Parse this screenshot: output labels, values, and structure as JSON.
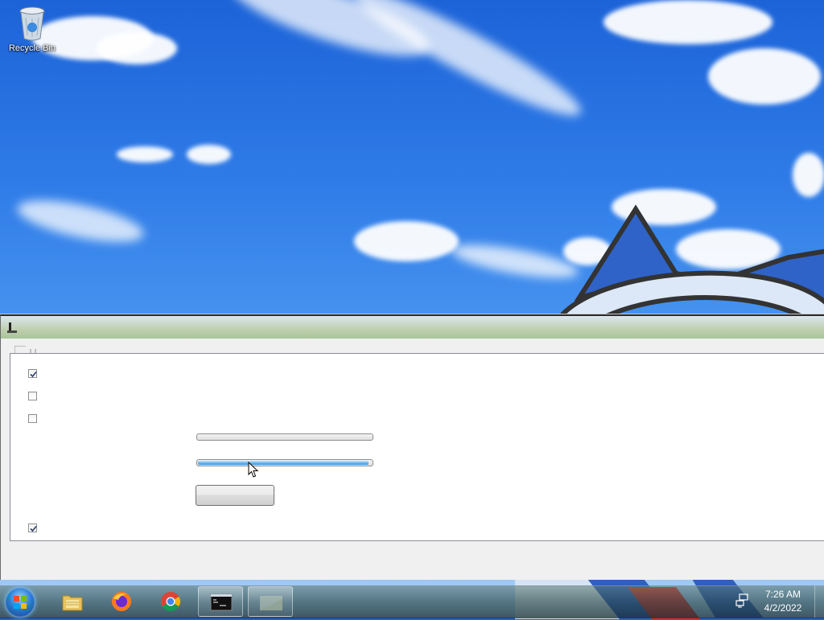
{
  "desktop": {
    "icons": [
      {
        "label": "Recycle Bin",
        "icon": "recycle-bin-icon"
      }
    ]
  },
  "window": {
    "title": "",
    "checkboxes": [
      {
        "checked": true
      },
      {
        "checked": false
      },
      {
        "checked": false
      },
      {
        "checked": true
      }
    ],
    "progress_bars": [
      {
        "value": 0.0
      },
      {
        "value": 0.98
      }
    ],
    "button_label": ""
  },
  "taskbar": {
    "start_icon": "windows-start-icon",
    "pinned": [
      {
        "name": "file-explorer-icon"
      },
      {
        "name": "firefox-icon"
      },
      {
        "name": "chrome-icon"
      },
      {
        "name": "command-prompt-icon",
        "active": true
      },
      {
        "name": "app-window-icon",
        "active": true
      }
    ],
    "tray": {
      "network_icon": "network-icon",
      "time": "7:26 AM",
      "date": "4/2/2022"
    }
  },
  "colors": {
    "progress_fill": "#3a93dc",
    "sky_top": "#1c63d8",
    "taskbar": "#283c3c"
  }
}
